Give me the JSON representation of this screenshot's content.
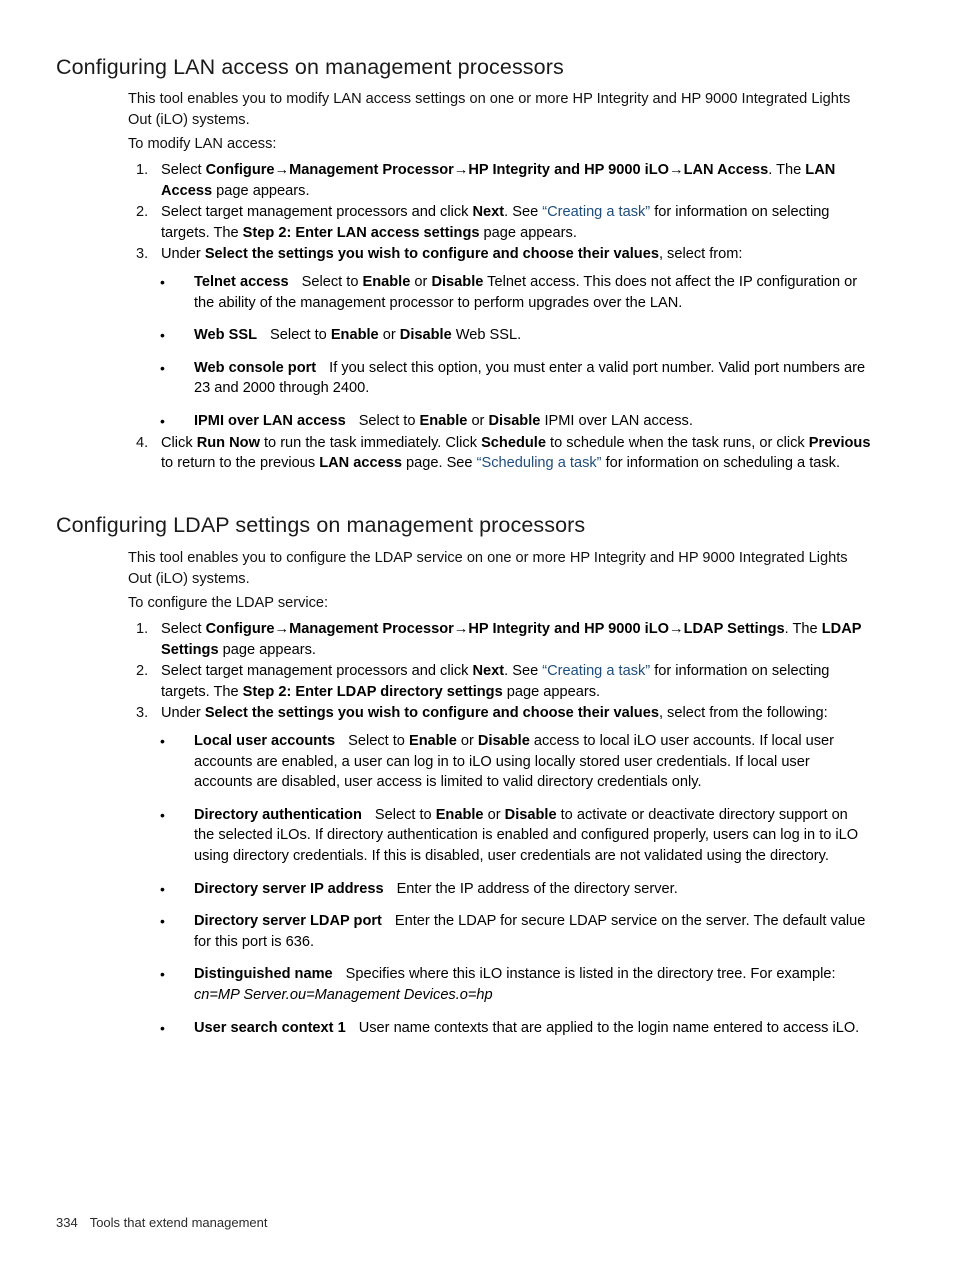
{
  "document": {
    "footer": {
      "page_number": "334",
      "chapter": "Tools that extend management"
    }
  },
  "sections": [
    {
      "id": "lan-access",
      "heading": "Configuring LAN access on management processors",
      "intro": "This tool enables you to modify LAN access settings on one or more HP Integrity and HP 9000 Integrated Lights Out (iLO) systems.",
      "lead_in": "To modify LAN access:",
      "steps": [
        {
          "number": "1.",
          "parts": [
            {
              "t": "Select ",
              "style": "normal"
            },
            {
              "t": "Configure",
              "style": "bold"
            },
            {
              "t": "→",
              "style": "arrow"
            },
            {
              "t": "Management Processor",
              "style": "bold"
            },
            {
              "t": "→",
              "style": "arrow"
            },
            {
              "t": "HP Integrity and HP 9000 iLO",
              "style": "bold"
            },
            {
              "t": "→",
              "style": "arrow"
            },
            {
              "t": "LAN Access",
              "style": "bold"
            },
            {
              "t": ". The ",
              "style": "normal"
            },
            {
              "t": "LAN Access",
              "style": "bold"
            },
            {
              "t": " page appears.",
              "style": "normal"
            }
          ]
        },
        {
          "number": "2.",
          "parts": [
            {
              "t": "Select target management processors and click ",
              "style": "normal"
            },
            {
              "t": "Next",
              "style": "bold"
            },
            {
              "t": ". See ",
              "style": "normal"
            },
            {
              "t": "“Creating a task”",
              "style": "link"
            },
            {
              "t": " for information on selecting targets. The ",
              "style": "normal"
            },
            {
              "t": "Step 2: Enter LAN access settings",
              "style": "bold"
            },
            {
              "t": " page appears.",
              "style": "normal"
            }
          ]
        },
        {
          "number": "3.",
          "parts": [
            {
              "t": "Under ",
              "style": "normal"
            },
            {
              "t": "Select the settings you wish to configure and choose their values",
              "style": "bold"
            },
            {
              "t": ", select from:",
              "style": "normal"
            }
          ],
          "bullets": [
            {
              "term": "Telnet access",
              "parts": [
                {
                  "t": "Select to ",
                  "style": "normal"
                },
                {
                  "t": "Enable",
                  "style": "bold"
                },
                {
                  "t": " or ",
                  "style": "normal"
                },
                {
                  "t": "Disable",
                  "style": "bold"
                },
                {
                  "t": " Telnet access. This does not affect the IP configuration or the ability of the management processor to perform upgrades over the LAN.",
                  "style": "normal"
                }
              ]
            },
            {
              "term": "Web SSL",
              "parts": [
                {
                  "t": "Select to ",
                  "style": "normal"
                },
                {
                  "t": "Enable",
                  "style": "bold"
                },
                {
                  "t": " or ",
                  "style": "normal"
                },
                {
                  "t": "Disable",
                  "style": "bold"
                },
                {
                  "t": " Web SSL.",
                  "style": "normal"
                }
              ]
            },
            {
              "term": "Web console port",
              "parts": [
                {
                  "t": "If you select this option, you must enter a valid port number. Valid port numbers are 23 and 2000 through 2400.",
                  "style": "normal"
                }
              ]
            },
            {
              "term": "IPMI over LAN access",
              "parts": [
                {
                  "t": "Select to ",
                  "style": "normal"
                },
                {
                  "t": "Enable",
                  "style": "bold"
                },
                {
                  "t": " or ",
                  "style": "normal"
                },
                {
                  "t": "Disable",
                  "style": "bold"
                },
                {
                  "t": " IPMI over LAN access.",
                  "style": "normal"
                }
              ]
            }
          ]
        },
        {
          "number": "4.",
          "parts": [
            {
              "t": "Click ",
              "style": "normal"
            },
            {
              "t": "Run Now",
              "style": "bold"
            },
            {
              "t": " to run the task immediately. Click ",
              "style": "normal"
            },
            {
              "t": "Schedule",
              "style": "bold"
            },
            {
              "t": " to schedule when the task runs, or click ",
              "style": "normal"
            },
            {
              "t": "Previous",
              "style": "bold"
            },
            {
              "t": " to return to the previous ",
              "style": "normal"
            },
            {
              "t": "LAN access",
              "style": "bold"
            },
            {
              "t": " page. See ",
              "style": "normal"
            },
            {
              "t": "“Scheduling a task”",
              "style": "link"
            },
            {
              "t": " for information on scheduling a task.",
              "style": "normal"
            }
          ]
        }
      ]
    },
    {
      "id": "ldap-settings",
      "heading": "Configuring LDAP settings on management processors",
      "intro": "This tool enables you to configure the LDAP service on one or more HP Integrity and HP 9000 Integrated Lights Out (iLO) systems.",
      "lead_in": "To configure the LDAP service:",
      "steps": [
        {
          "number": "1.",
          "parts": [
            {
              "t": "Select ",
              "style": "normal"
            },
            {
              "t": "Configure",
              "style": "bold"
            },
            {
              "t": "→",
              "style": "arrow"
            },
            {
              "t": "Management Processor",
              "style": "bold"
            },
            {
              "t": "→",
              "style": "arrow"
            },
            {
              "t": "HP Integrity and HP 9000 iLO",
              "style": "bold"
            },
            {
              "t": "→",
              "style": "arrow"
            },
            {
              "t": "LDAP Settings",
              "style": "bold"
            },
            {
              "t": ". The ",
              "style": "normal"
            },
            {
              "t": "LDAP Settings",
              "style": "bold"
            },
            {
              "t": " page appears.",
              "style": "normal"
            }
          ]
        },
        {
          "number": "2.",
          "parts": [
            {
              "t": "Select target management processors and click ",
              "style": "normal"
            },
            {
              "t": "Next",
              "style": "bold"
            },
            {
              "t": ". See ",
              "style": "normal"
            },
            {
              "t": "“Creating a task”",
              "style": "link"
            },
            {
              "t": " for information on selecting targets. The ",
              "style": "normal"
            },
            {
              "t": "Step 2: Enter LDAP directory settings",
              "style": "bold"
            },
            {
              "t": " page appears.",
              "style": "normal"
            }
          ]
        },
        {
          "number": "3.",
          "parts": [
            {
              "t": "Under ",
              "style": "normal"
            },
            {
              "t": "Select the settings you wish to configure and choose their values",
              "style": "bold"
            },
            {
              "t": ", select from the following:",
              "style": "normal"
            }
          ],
          "bullets": [
            {
              "term": "Local user accounts",
              "parts": [
                {
                  "t": "Select to ",
                  "style": "normal"
                },
                {
                  "t": "Enable",
                  "style": "bold"
                },
                {
                  "t": " or ",
                  "style": "normal"
                },
                {
                  "t": "Disable",
                  "style": "bold"
                },
                {
                  "t": " access to local iLO user accounts. If local user accounts are enabled, a user can log in to iLO using locally stored user credentials. If local user accounts are disabled, user access is limited to valid directory credentials only.",
                  "style": "normal"
                }
              ]
            },
            {
              "term": "Directory authentication",
              "parts": [
                {
                  "t": "Select to ",
                  "style": "normal"
                },
                {
                  "t": "Enable",
                  "style": "bold"
                },
                {
                  "t": " or ",
                  "style": "normal"
                },
                {
                  "t": "Disable",
                  "style": "bold"
                },
                {
                  "t": " to activate or deactivate directory support on the selected iLOs. If directory authentication is enabled and configured properly, users can log in to iLO using directory credentials. If this is disabled, user credentials are not validated using the directory.",
                  "style": "normal"
                }
              ]
            },
            {
              "term": "Directory server IP address",
              "parts": [
                {
                  "t": "Enter the IP address of the directory server.",
                  "style": "normal"
                }
              ]
            },
            {
              "term": "Directory server LDAP port",
              "parts": [
                {
                  "t": "Enter the LDAP for secure LDAP service on the server. The default value for this port is 636.",
                  "style": "normal"
                }
              ]
            },
            {
              "term": "Distinguished name",
              "parts": [
                {
                  "t": "Specifies where this iLO instance is listed in the directory tree. For example: ",
                  "style": "normal"
                },
                {
                  "t": "cn=MP Server.ou=Management Devices.o=hp",
                  "style": "italic"
                }
              ]
            },
            {
              "term": "User search context 1",
              "parts": [
                {
                  "t": "User name contexts that are applied to the login name entered to access iLO.",
                  "style": "normal"
                }
              ]
            }
          ]
        }
      ]
    }
  ]
}
